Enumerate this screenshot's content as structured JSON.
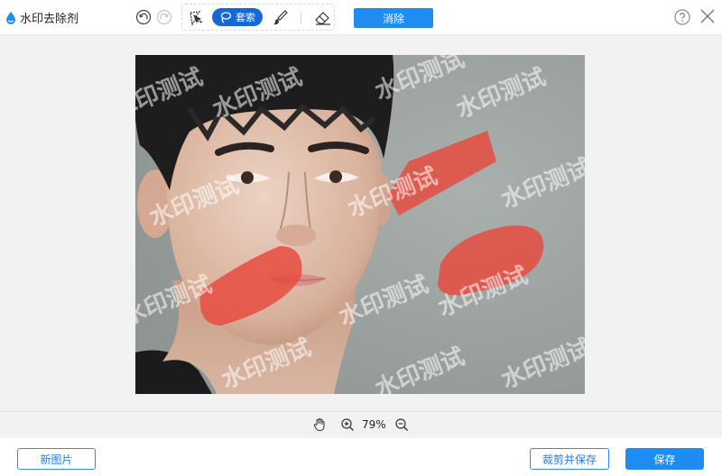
{
  "app": {
    "title": "水印去除剂"
  },
  "toolbar": {
    "tools": {
      "lasso_label": "套索"
    },
    "erase_label": "消除"
  },
  "canvas": {
    "watermark_text": "水印测试",
    "photo_subject": "portrait photo"
  },
  "zoom": {
    "value": "79%"
  },
  "footer": {
    "new_image_label": "新图片",
    "crop_save_label": "裁剪并保存",
    "save_label": "保存"
  },
  "colors": {
    "accent": "#1e8cf0",
    "lasso_active": "#1668d4",
    "mask": "#e8483c",
    "canvas_bg": "#f2f2f3"
  }
}
